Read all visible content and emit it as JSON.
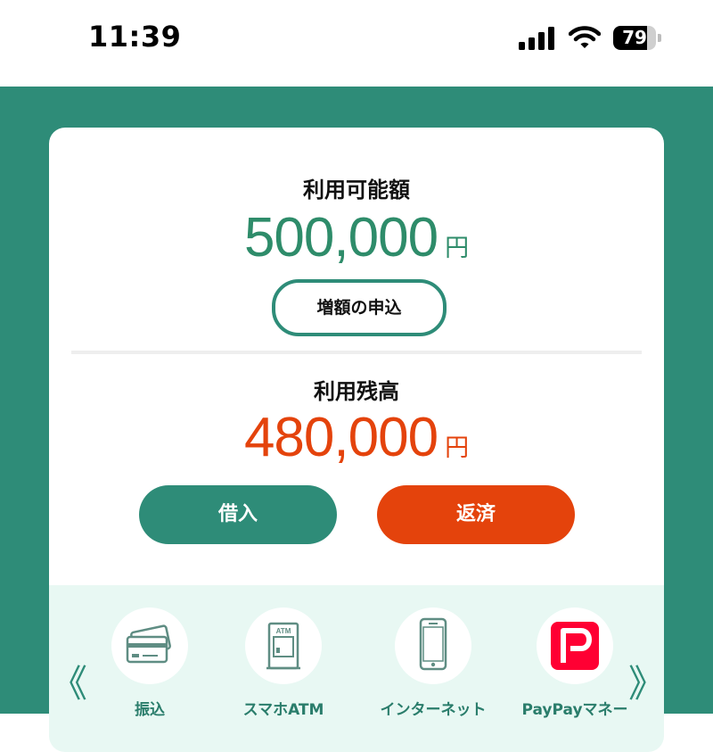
{
  "status_bar": {
    "time": "11:39",
    "battery_percent": "79",
    "battery_level": 0.79
  },
  "colors": {
    "brand_green": "#2e8c78",
    "accent_orange": "#e4430c",
    "light_mint": "#e8f8f3"
  },
  "credit": {
    "available_label": "利用可能額",
    "available_amount": "500,000",
    "available_unit": "円",
    "increase_button": "増額の申込",
    "balance_label": "利用残高",
    "balance_amount": "480,000",
    "balance_unit": "円"
  },
  "actions": {
    "borrow_label": "借入",
    "repay_label": "返済"
  },
  "shortcuts": [
    {
      "label": "振込",
      "icon": "card-transfer-icon"
    },
    {
      "label": "スマホATM",
      "icon": "atm-icon"
    },
    {
      "label": "インターネット",
      "icon": "smartphone-icon"
    },
    {
      "label": "PayPayマネー",
      "icon": "paypay-icon"
    }
  ],
  "nav": {
    "prev_glyph": "《",
    "next_glyph": "》"
  }
}
